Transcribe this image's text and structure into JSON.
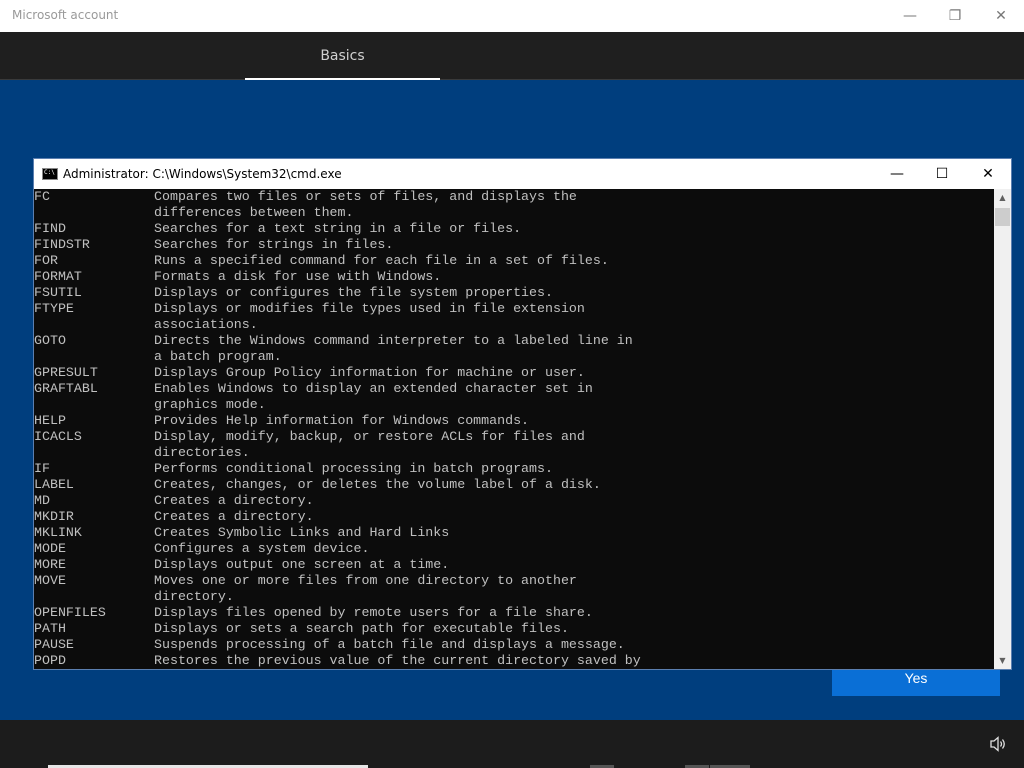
{
  "app": {
    "title": "Microsoft account",
    "minimize_icon": "—",
    "restore_icon": "❐",
    "close_icon": "✕"
  },
  "nav": {
    "tab_label": "Basics"
  },
  "setup": {
    "yes_label": "Yes"
  },
  "cmd": {
    "title": "Administrator:  C:\\Windows\\System32\\cmd.exe",
    "minimize_icon": "—",
    "maximize_icon": "☐",
    "close_icon": "✕",
    "lines": [
      {
        "name": "FC",
        "desc": "Compares two files or sets of files, and displays the"
      },
      {
        "name": "",
        "desc": "differences between them."
      },
      {
        "name": "FIND",
        "desc": "Searches for a text string in a file or files."
      },
      {
        "name": "FINDSTR",
        "desc": "Searches for strings in files."
      },
      {
        "name": "FOR",
        "desc": "Runs a specified command for each file in a set of files."
      },
      {
        "name": "FORMAT",
        "desc": "Formats a disk for use with Windows."
      },
      {
        "name": "FSUTIL",
        "desc": "Displays or configures the file system properties."
      },
      {
        "name": "FTYPE",
        "desc": "Displays or modifies file types used in file extension"
      },
      {
        "name": "",
        "desc": "associations."
      },
      {
        "name": "GOTO",
        "desc": "Directs the Windows command interpreter to a labeled line in"
      },
      {
        "name": "",
        "desc": "a batch program."
      },
      {
        "name": "GPRESULT",
        "desc": "Displays Group Policy information for machine or user."
      },
      {
        "name": "GRAFTABL",
        "desc": "Enables Windows to display an extended character set in"
      },
      {
        "name": "",
        "desc": "graphics mode."
      },
      {
        "name": "HELP",
        "desc": "Provides Help information for Windows commands."
      },
      {
        "name": "ICACLS",
        "desc": "Display, modify, backup, or restore ACLs for files and"
      },
      {
        "name": "",
        "desc": "directories."
      },
      {
        "name": "IF",
        "desc": "Performs conditional processing in batch programs."
      },
      {
        "name": "LABEL",
        "desc": "Creates, changes, or deletes the volume label of a disk."
      },
      {
        "name": "MD",
        "desc": "Creates a directory."
      },
      {
        "name": "MKDIR",
        "desc": "Creates a directory."
      },
      {
        "name": "MKLINK",
        "desc": "Creates Symbolic Links and Hard Links"
      },
      {
        "name": "MODE",
        "desc": "Configures a system device."
      },
      {
        "name": "MORE",
        "desc": "Displays output one screen at a time."
      },
      {
        "name": "MOVE",
        "desc": "Moves one or more files from one directory to another"
      },
      {
        "name": "",
        "desc": "directory."
      },
      {
        "name": "OPENFILES",
        "desc": "Displays files opened by remote users for a file share."
      },
      {
        "name": "PATH",
        "desc": "Displays or sets a search path for executable files."
      },
      {
        "name": "PAUSE",
        "desc": "Suspends processing of a batch file and displays a message."
      },
      {
        "name": "POPD",
        "desc": "Restores the previous value of the current directory saved by"
      }
    ]
  },
  "colors": {
    "background": "#003e7e",
    "console_bg": "#0c0c0c",
    "console_text": "#c0c0c0",
    "button_accent": "#0a6fd6"
  }
}
